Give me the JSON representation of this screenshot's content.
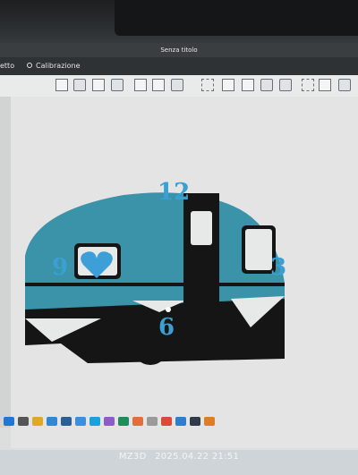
{
  "window": {
    "title": "Senza titolo"
  },
  "menu": {
    "items": [
      "etto",
      "Calibrazione"
    ]
  },
  "toolbar": {
    "tools": [
      "new-layer-icon",
      "grid-icon",
      "image-icon",
      "table-icon",
      "copy-icon",
      "paste-icon",
      "layers-icon",
      "move-icon",
      "rotate-icon",
      "scale-icon",
      "align-icon",
      "distribute-icon",
      "shape-icon",
      "cube-icon",
      "frame-icon"
    ]
  },
  "canvas": {
    "clock_numbers": {
      "top": "12",
      "right": "3",
      "bottom": "6",
      "left": "9"
    },
    "colors": {
      "teal": "#3a93a8",
      "black": "#151515",
      "clock_blue": "#3a9fd2",
      "heart": "#3d9fd8"
    }
  },
  "photo_overlay": {
    "device": "MZ3D",
    "timestamp": "2025.04.22 21:51"
  },
  "taskbar": {
    "icons": [
      "start-icon",
      "search-icon",
      "file-explorer-icon",
      "folder-icon",
      "store-icon",
      "mail-icon",
      "browser-icon",
      "app-icon",
      "edge-icon",
      "photos-icon",
      "settings-icon",
      "chrome-icon",
      "vscode-icon",
      "steam-icon",
      "app-icon-2"
    ]
  }
}
